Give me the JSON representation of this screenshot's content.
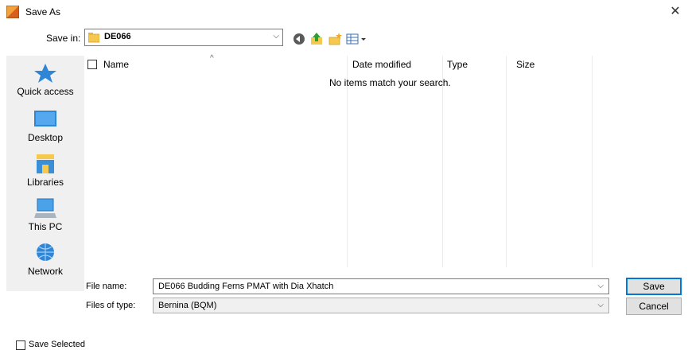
{
  "window": {
    "title": "Save As",
    "close_glyph": "✕"
  },
  "toolbar": {
    "save_in_label": "Save in:",
    "save_in_value": "DE066",
    "dropdown_glyph": "⌵",
    "buttons": [
      "back-icon",
      "up-folder-icon",
      "new-folder-icon",
      "view-menu-icon"
    ]
  },
  "places": [
    {
      "label": "Quick access",
      "icon": "quick-access-star-icon"
    },
    {
      "label": "Desktop",
      "icon": "desktop-icon"
    },
    {
      "label": "Libraries",
      "icon": "libraries-icon"
    },
    {
      "label": "This PC",
      "icon": "this-pc-icon"
    },
    {
      "label": "Network",
      "icon": "network-icon"
    }
  ],
  "list": {
    "columns": [
      "Name",
      "Date modified",
      "Type",
      "Size"
    ],
    "sort_glyph": "^",
    "empty_message": "No items match your search."
  },
  "fields": {
    "file_name_label": "File name:",
    "file_name_value": "DE066 Budding Ferns PMAT with Dia Xhatch",
    "file_type_label": "Files of type:",
    "file_type_value": "Bernina (BQM)"
  },
  "buttons": {
    "save": "Save",
    "cancel": "Cancel"
  },
  "footer": {
    "save_selected_label": "Save Selected"
  },
  "colors": {
    "accent": "#0078d7",
    "folder": "#f5c94e",
    "places_bg": "#f0f0f0"
  }
}
